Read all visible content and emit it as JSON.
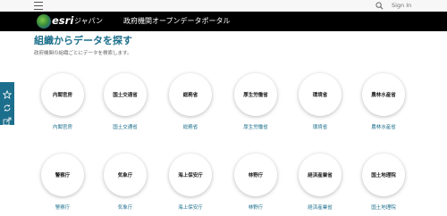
{
  "topbar": {
    "signin_label": "Sign In"
  },
  "header": {
    "logo_text": "esri",
    "logo_sub": "ジャパン",
    "portal_title": "政府機関オープンデータポータル"
  },
  "page": {
    "title": "組織からデータを探す",
    "description": "政府機関の組織ごとにデータを検索します。"
  },
  "side_toolbar": {
    "icons": [
      "star-icon",
      "refresh-icon",
      "share-icon"
    ]
  },
  "agencies": [
    {
      "circle_label": "内閣官房",
      "link_label": "内閣官房"
    },
    {
      "circle_label": "国土交通省",
      "link_label": "国土交通省"
    },
    {
      "circle_label": "総務省",
      "link_label": "総務省"
    },
    {
      "circle_label": "厚生労働省",
      "link_label": "厚生労働省"
    },
    {
      "circle_label": "環境省",
      "link_label": "環境省"
    },
    {
      "circle_label": "農林水産省",
      "link_label": "農林水産省"
    },
    {
      "circle_label": "警察庁",
      "link_label": "警察庁"
    },
    {
      "circle_label": "気象庁",
      "link_label": "気象庁"
    },
    {
      "circle_label": "海上保安庁",
      "link_label": "海上保安庁"
    },
    {
      "circle_label": "林野庁",
      "link_label": "林野庁"
    },
    {
      "circle_label": "経済産業省",
      "link_label": "経済産業省"
    },
    {
      "circle_label": "国土地理院",
      "link_label": "国土地理院"
    }
  ],
  "colors": {
    "accent": "#1c6f8c",
    "header_bg": "#000000",
    "topbar_bg": "#f7f7f7"
  }
}
